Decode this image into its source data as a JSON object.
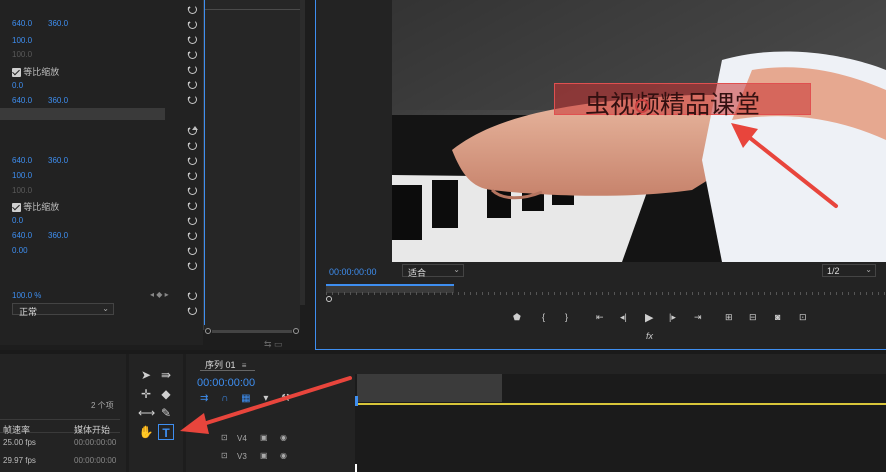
{
  "effects_panel": {
    "rows": [
      {
        "v1": "640.0",
        "v2": "360.0"
      },
      {
        "v1": "100.0"
      },
      {
        "v1": "100.0",
        "dim": true
      },
      {
        "checkbox_label": "等比缩放"
      },
      {
        "v1": "0.0"
      },
      {
        "v1": "640.0",
        "v2": "360.0"
      },
      {
        "v1": "640.0",
        "v2": "360.0"
      },
      {
        "v1": "100.0"
      },
      {
        "v1": "100.0",
        "dim": true
      },
      {
        "checkbox_label": "等比缩放"
      },
      {
        "v1": "0.0"
      },
      {
        "v1": "640.0",
        "v2": "360.0"
      },
      {
        "v1": "0.00"
      }
    ],
    "opacity_value": "100.0 %",
    "blend_mode": "正常"
  },
  "program_monitor": {
    "subtitle_text": "虫视频精品课堂",
    "timecode": "00:00:00:00",
    "fit_label": "适合",
    "resolution": "1/2",
    "fx_label": "fx"
  },
  "project_panel": {
    "item_count": "2 个项",
    "col_framerate": "帧速率",
    "col_media_start": "媒体开始",
    "rows": [
      {
        "fps": "25.00 fps",
        "start": "00:00:00:00"
      },
      {
        "fps": "29.97 fps",
        "start": "00:00:00:00"
      }
    ]
  },
  "timeline": {
    "sequence_name": "序列 01",
    "timecode": "00:00:00:00",
    "tracks": [
      "V4",
      "V3"
    ]
  },
  "colors": {
    "accent": "#3e8ef0",
    "playhead": "#d8c53a",
    "arrow": "#e8453c"
  }
}
